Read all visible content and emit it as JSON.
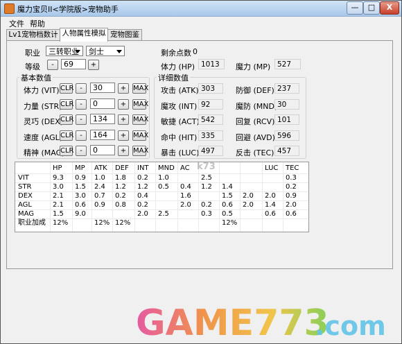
{
  "window": {
    "title": "魔力宝贝II<学院版>宠物助手",
    "controls": {
      "minimize": "—",
      "maximize": "□",
      "close": "X"
    }
  },
  "menu": [
    "文件",
    "帮助"
  ],
  "tabs": [
    "Lv1宠物档数计算",
    "人物属性模拟",
    "宠物图鉴"
  ],
  "form": {
    "job_label": "职业",
    "job_tier": "三转职业",
    "job_class": "剑士",
    "level_label": "等级",
    "level_value": "69",
    "remaining_points_label": "剩余点数",
    "remaining_points_value": "0",
    "hp_label": "体力 (HP)",
    "hp_value": "1013",
    "mp_label": "魔力 (MP)",
    "mp_value": "527",
    "minus": "-",
    "plus": "+",
    "clr": "CLR",
    "max": "MAX"
  },
  "base": {
    "title": "基本数值",
    "stats": [
      {
        "label": "体力 (VIT)",
        "value": "30"
      },
      {
        "label": "力量 (STR)",
        "value": "0"
      },
      {
        "label": "灵巧 (DEX)",
        "value": "134"
      },
      {
        "label": "速度 (AGL)",
        "value": "164"
      },
      {
        "label": "精神 (MAG)",
        "value": "0"
      }
    ]
  },
  "detail": {
    "title": "详细数值",
    "left": [
      {
        "label": "攻击 (ATK)",
        "value": "303"
      },
      {
        "label": "魔攻 (INT)",
        "value": "92"
      },
      {
        "label": "敏捷 (ACT)",
        "value": "542"
      },
      {
        "label": "命中 (HIT)",
        "value": "335"
      },
      {
        "label": "暴击 (LUC)",
        "value": "497"
      }
    ],
    "right": [
      {
        "label": "防御 (DEF)",
        "value": "237"
      },
      {
        "label": "魔防 (MND)",
        "value": "30"
      },
      {
        "label": "回复 (RCV)",
        "value": "101"
      },
      {
        "label": "回避 (AVD)",
        "value": "596"
      },
      {
        "label": "反击 (TEC)",
        "value": "457"
      }
    ]
  },
  "table": {
    "headers": [
      "",
      "HP",
      "MP",
      "ATK",
      "DEF",
      "INT",
      "MND",
      "AC",
      "",
      "",
      "",
      "LUC",
      "TEC"
    ],
    "rows": [
      [
        "VIT",
        "9.3",
        "0.9",
        "1.0",
        "1.8",
        "0.2",
        "1.0",
        "",
        "2.5",
        "",
        "",
        "",
        "0.3"
      ],
      [
        "STR",
        "3.0",
        "1.5",
        "2.4",
        "1.2",
        "1.2",
        "0.5",
        "0.4",
        "1.2",
        "1.4",
        "",
        "",
        "0.2"
      ],
      [
        "DEX",
        "2.1",
        "3.0",
        "0.7",
        "0.2",
        "0.4",
        "",
        "1.6",
        "",
        "1.5",
        "2.0",
        "2.0",
        "0.9"
      ],
      [
        "AGL",
        "2.1",
        "0.6",
        "0.9",
        "0.8",
        "0.2",
        "",
        "2.0",
        "0.2",
        "0.6",
        "2.0",
        "1.4",
        "2.0"
      ],
      [
        "MAG",
        "1.5",
        "9.0",
        "",
        "",
        "2.0",
        "2.5",
        "",
        "0.3",
        "0.5",
        "",
        "0.6",
        "0.6"
      ],
      [
        "职业加成",
        "12%",
        "",
        "12%",
        "12%",
        "",
        "",
        "",
        "",
        "12%",
        "",
        "",
        ""
      ]
    ]
  },
  "watermark": {
    "main": "GAME773",
    "suffix": ".com",
    "site": "k73"
  }
}
